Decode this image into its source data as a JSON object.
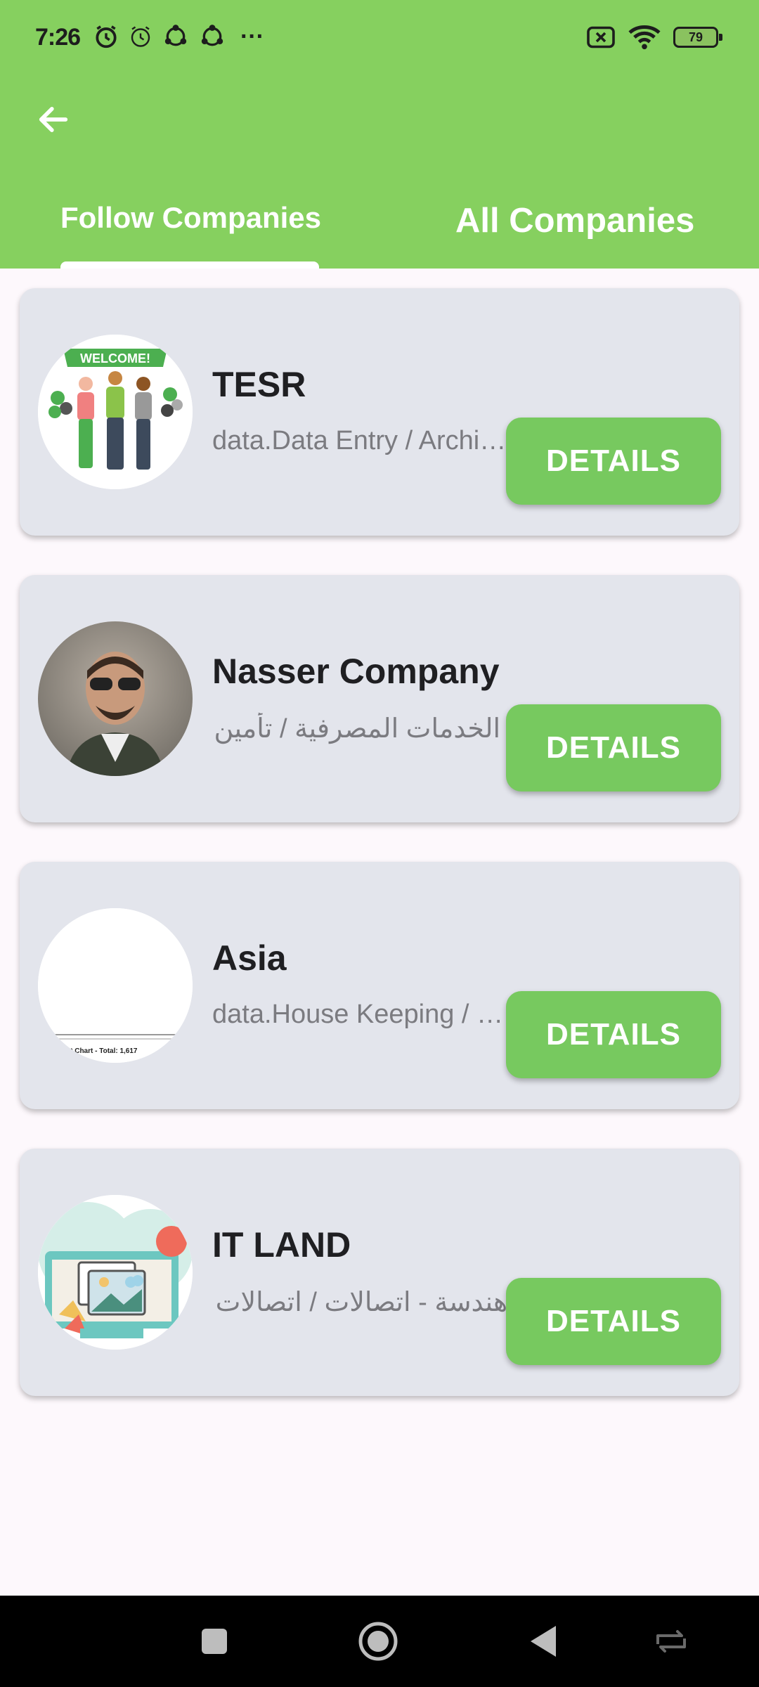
{
  "status_bar": {
    "time": "7:26",
    "battery": "79",
    "more": "···"
  },
  "tabs": [
    {
      "label": "Follow Companies",
      "selected": true
    },
    {
      "label": "All Companies",
      "selected": false
    }
  ],
  "companies": [
    {
      "name": "TESR",
      "category": "data.Data Entry / Architecture",
      "button": "DETAILS",
      "avatar": "welcome-illustration"
    },
    {
      "name": "Nasser Company",
      "category": "الخدمات المصرفية / تأمين",
      "button": "DETAILS",
      "avatar": "person-photo"
    },
    {
      "name": "Asia",
      "category": "data.House Keeping / Services",
      "button": "DETAILS",
      "avatar": "chart-thumbnail",
      "avatar_caption": "nt Chart - Total: 1,617"
    },
    {
      "name": "IT LAND",
      "category": "هندسة - اتصالات / اتصالات",
      "button": "DETAILS",
      "avatar": "monitor-illustration"
    }
  ],
  "colors": {
    "appbar": "#86d05f",
    "button": "#77c95f",
    "card": "#e3e5ec",
    "background": "#fdf8fc"
  },
  "icons": {
    "back": "arrow-left-icon",
    "nav_recent": "square-icon",
    "nav_home": "circle-icon",
    "nav_back": "triangle-back-icon",
    "nav_switch": "switch-icon"
  }
}
